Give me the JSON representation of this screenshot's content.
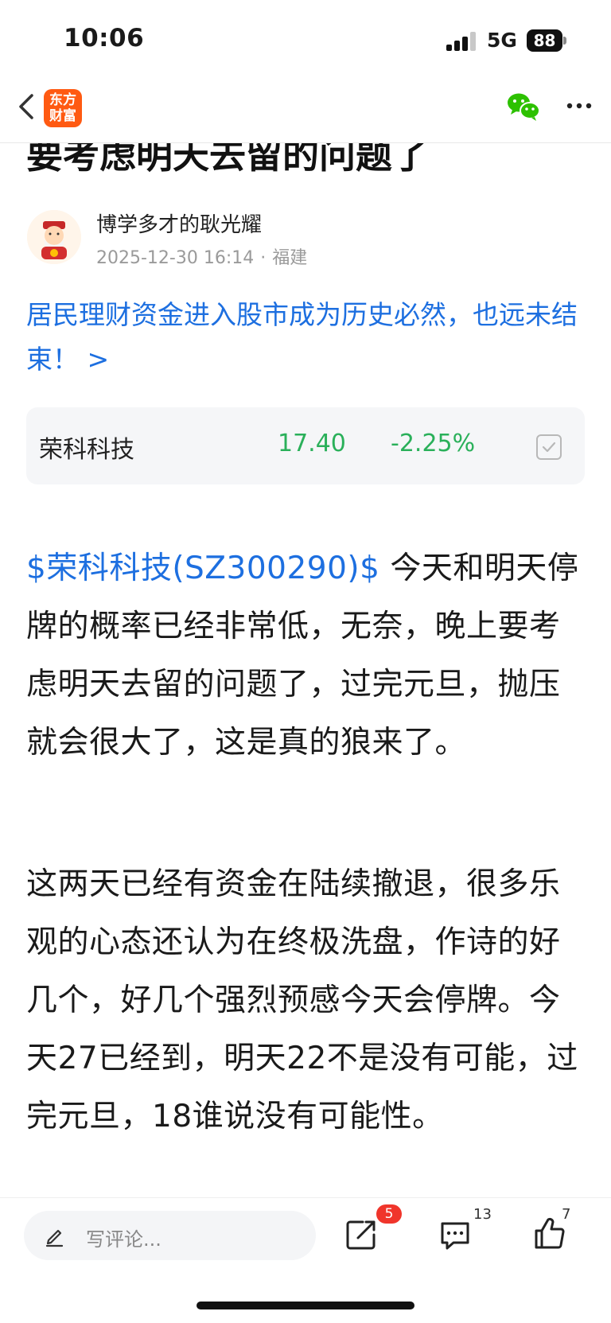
{
  "status_bar": {
    "time": "10:06",
    "network": "5G",
    "battery": "88"
  },
  "nav": {
    "logo_line1": "东方",
    "logo_line2": "财富",
    "back_icon": "chevron-left-icon",
    "wechat_icon": "wechat-icon",
    "more_icon": "more-icon",
    "brand_color": "#ff5a12"
  },
  "post": {
    "title_peek": "要考虑明天去留的问题了",
    "author": {
      "name": "博学多才的耿光耀",
      "date": "2025-12-30 16:14",
      "separator": "·",
      "location": "福建"
    },
    "topic_link": "居民理财资金进入股市成为历史必然，也远未结束！ >",
    "stock": {
      "name": "荣科科技",
      "price": "17.40",
      "change": "-2.25%",
      "color": "#2ab05a"
    },
    "stock_tag": "$荣科科技(SZ300290)$",
    "paragraph1": " 今天和明天停牌的概率已经非常低，无奈，晚上要考虑明天去留的问题了，过完元旦，抛压就会很大了，这是真的狼来了。",
    "paragraph2": "这两天已经有资金在陆续撤退，很多乐观的心态还认为在终极洗盘，作诗的好几个，好几个强烈预感今天会停牌。今天27已经到，明天22不是没有可能，过完元旦，18谁说没有可能性。",
    "link_color": "#1d6fe0"
  },
  "bottom_bar": {
    "comment_placeholder": "写评论...",
    "share_count": "5",
    "comment_count": "13",
    "like_count": "7"
  }
}
